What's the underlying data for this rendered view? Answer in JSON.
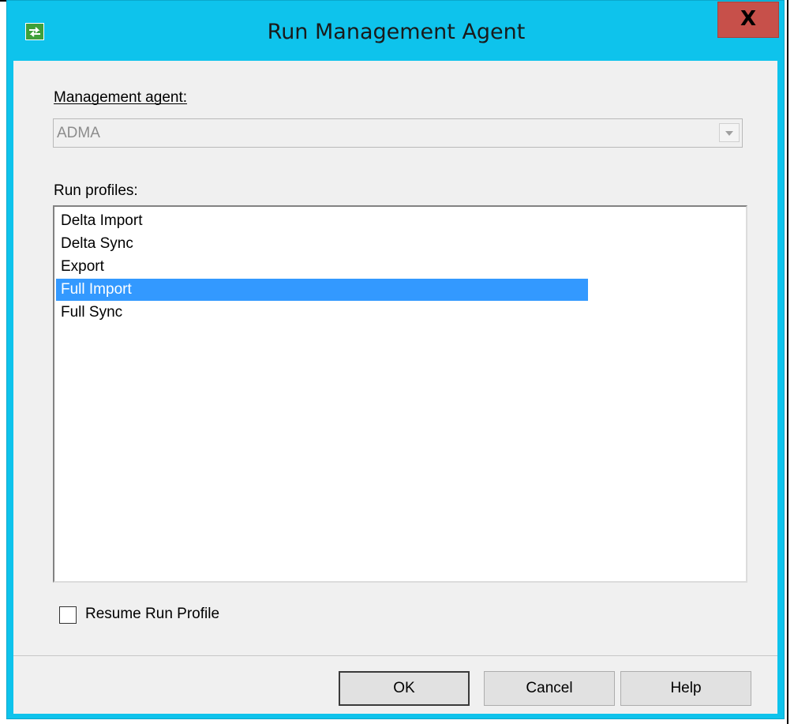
{
  "window": {
    "title": "Run Management Agent",
    "close_label": "X",
    "accent_color": "#0ec3ec"
  },
  "management_agent": {
    "label": "Management agent:",
    "value": "ADMA"
  },
  "run_profiles": {
    "label": "Run profiles:",
    "items": [
      {
        "label": "Delta Import",
        "selected": false
      },
      {
        "label": "Delta Sync",
        "selected": false
      },
      {
        "label": "Export",
        "selected": false
      },
      {
        "label": "Full Import",
        "selected": true
      },
      {
        "label": "Full Sync",
        "selected": false
      }
    ]
  },
  "resume_run_profile": {
    "label": "Resume Run Profile",
    "checked": false
  },
  "buttons": {
    "ok": "OK",
    "cancel": "Cancel",
    "help": "Help"
  }
}
